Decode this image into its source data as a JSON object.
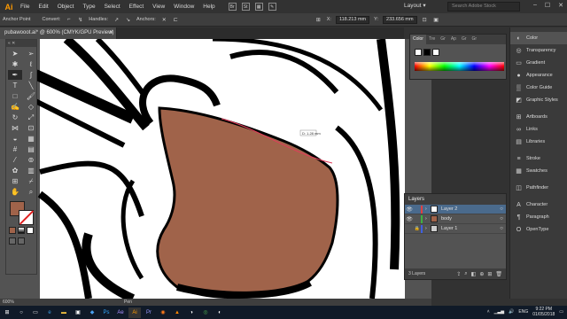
{
  "app": {
    "logo": "Ai"
  },
  "menubar": {
    "items": [
      "File",
      "Edit",
      "Object",
      "Type",
      "Select",
      "Effect",
      "View",
      "Window",
      "Help"
    ],
    "workspace": "Layout",
    "search_placeholder": "Search Adobe Stock",
    "icons": [
      "bridge-icon",
      "stock-icon",
      "arrange-icon",
      "brush-icon"
    ]
  },
  "controlbar": {
    "selection_label": "Anchor Point",
    "convert_label": "Convert:",
    "handles_label": "Handles:",
    "anchors_label": "Anchors:",
    "x_value": "118.213 mm",
    "y_value": "233.656 mm"
  },
  "document": {
    "tab_title": "pubawooot.ai* @ 600% (CMYK/GPU Preview)",
    "zoom": "600%",
    "status_tool": "Pen",
    "tooltip": "D: 1.28 mm"
  },
  "color_panel": {
    "tabs": [
      "Color",
      "Tre",
      "Gr",
      "Ap",
      "Gr",
      "Gr"
    ],
    "fill_color": "#a0634a",
    "stroke_color": "#ffffff"
  },
  "right_dock": {
    "items": [
      {
        "label": "Color",
        "icon": "color-icon"
      },
      {
        "label": "Transparency",
        "icon": "transparency-icon"
      },
      {
        "label": "Gradient",
        "icon": "gradient-icon"
      },
      {
        "label": "Appearance",
        "icon": "appearance-icon"
      },
      {
        "label": "Color Guide",
        "icon": "color-guide-icon"
      },
      {
        "label": "Graphic Styles",
        "icon": "graphic-styles-icon"
      },
      {
        "label": "Artboards",
        "icon": "artboards-icon"
      },
      {
        "label": "Links",
        "icon": "links-icon"
      },
      {
        "label": "Libraries",
        "icon": "libraries-icon"
      },
      {
        "label": "Stroke",
        "icon": "stroke-icon"
      },
      {
        "label": "Swatches",
        "icon": "swatches-icon"
      },
      {
        "label": "Pathfinder",
        "icon": "pathfinder-icon"
      },
      {
        "label": "Character",
        "icon": "character-icon"
      },
      {
        "label": "Paragraph",
        "icon": "paragraph-icon"
      },
      {
        "label": "OpenType",
        "icon": "opentype-icon"
      }
    ]
  },
  "layers_panel": {
    "title": "Layers",
    "layers": [
      {
        "name": "Layer 2",
        "color": "#e04040",
        "selected": true
      },
      {
        "name": "body",
        "color": "#40b040",
        "selected": false
      },
      {
        "name": "Layer 1",
        "color": "#4060e0",
        "selected": false
      }
    ],
    "count": "3 Layers"
  },
  "taskbar": {
    "time": "9:22 PM",
    "date": "01/05/2018",
    "lang": "ENG"
  }
}
